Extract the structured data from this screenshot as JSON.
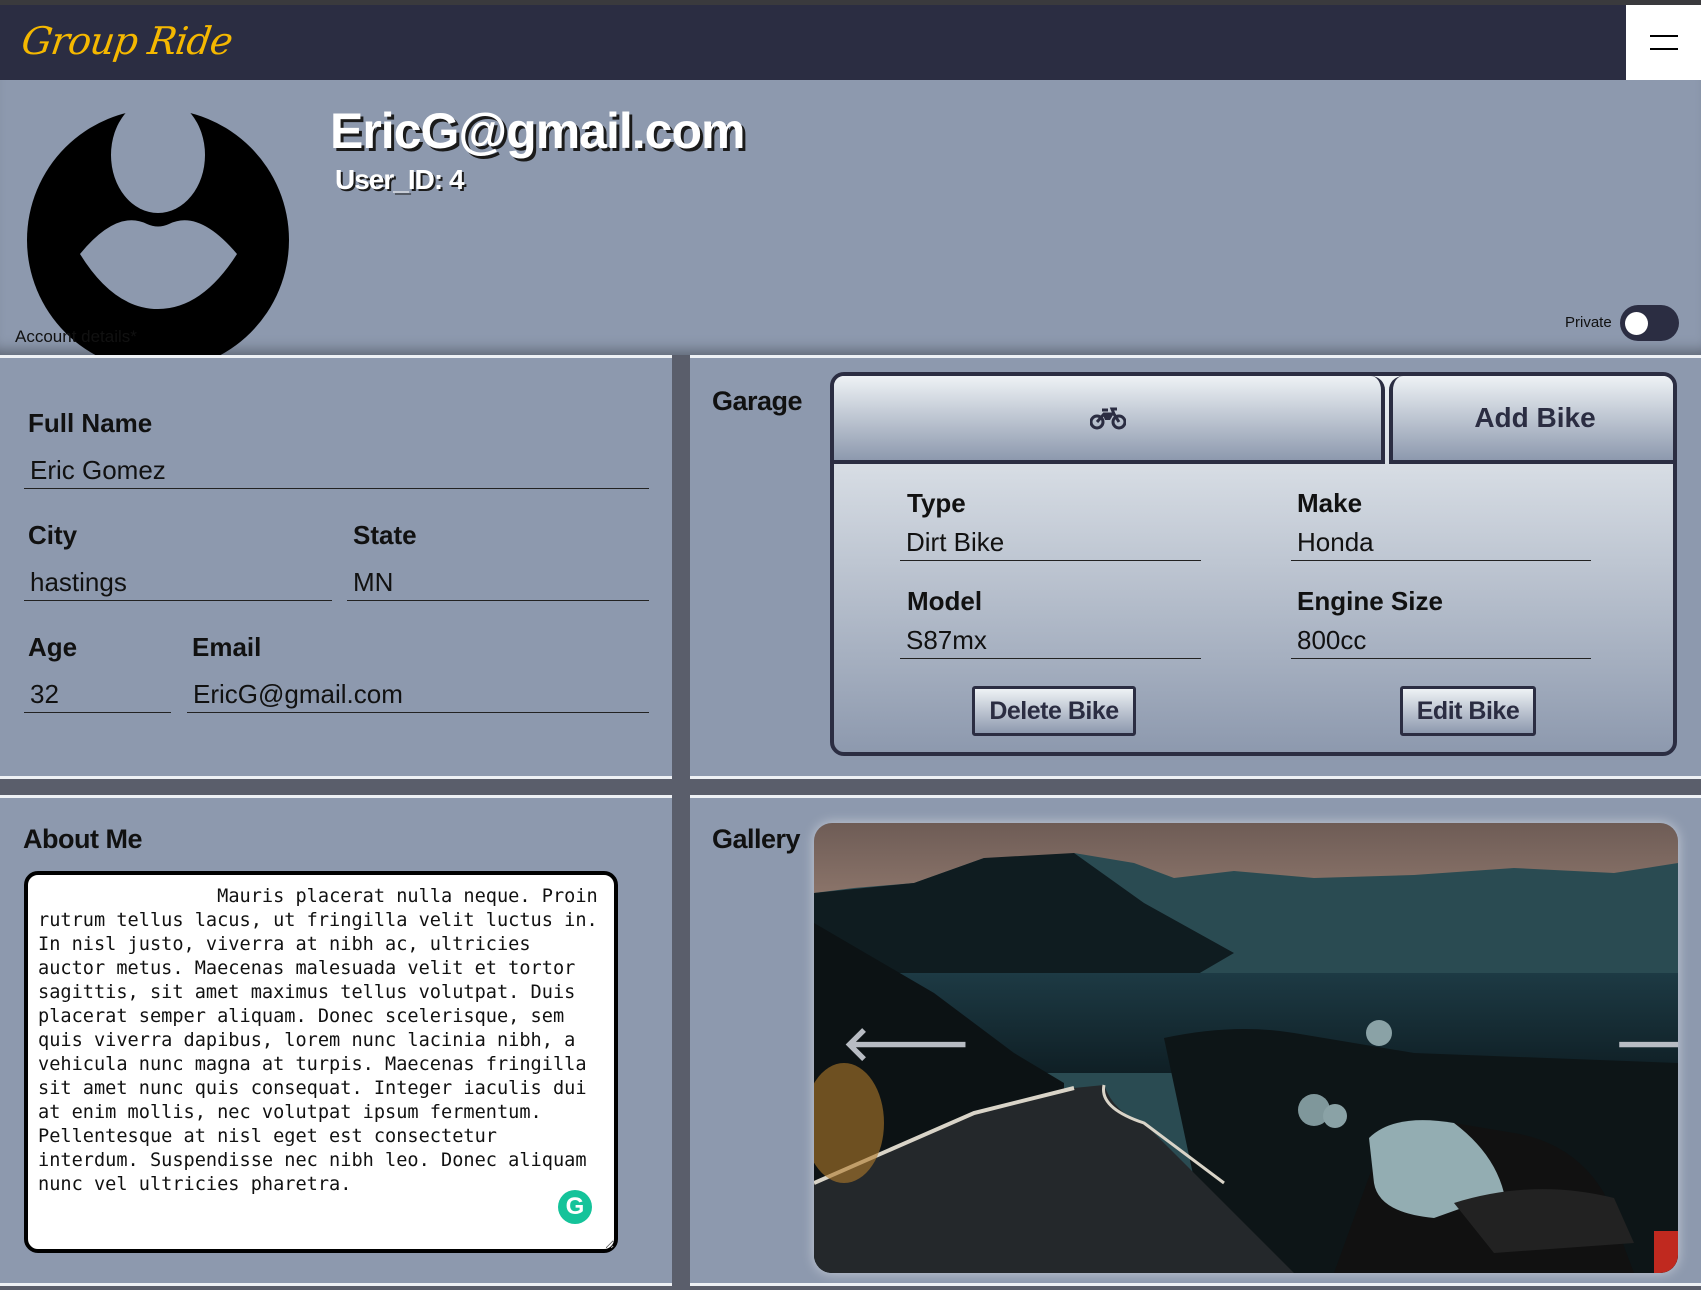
{
  "app": {
    "logo_text": "Group Ride",
    "menu_icon": "hamburger-icon"
  },
  "profile": {
    "email_title": "EricG@gmail.com",
    "user_id": "User_ID: 4",
    "account_details_label": "Account details*",
    "private_label": "Private",
    "private_enabled": false
  },
  "account": {
    "full_name_label": "Full Name",
    "full_name": "Eric Gomez",
    "city_label": "City",
    "city": "hastings",
    "state_label": "State",
    "state": "MN",
    "age_label": "Age",
    "age": "32",
    "email_label": "Email",
    "email": "EricG@gmail.com"
  },
  "garage": {
    "title": "Garage",
    "bike_tab_icon": "motorcycle-icon",
    "add_bike_label": "Add Bike",
    "type_label": "Type",
    "type": "Dirt Bike",
    "make_label": "Make",
    "make": "Honda",
    "model_label": "Model",
    "model": "S87mx",
    "engine_label": "Engine Size",
    "engine": "800cc",
    "delete_label": "Delete Bike",
    "edit_label": "Edit Bike"
  },
  "about": {
    "title": "About Me",
    "text": "                Mauris placerat nulla neque. Proin rutrum tellus lacus, ut fringilla velit luctus in. In nisl justo, viverra at nibh ac, ultricies auctor metus. Maecenas malesuada velit et tortor sagittis, sit amet maximus tellus volutpat. Duis placerat semper aliquam. Donec scelerisque, sem quis viverra dapibus, lorem nunc lacinia nibh, a vehicula nunc magna at turpis. Maecenas fringilla sit amet nunc quis consequat. Integer iaculis dui at enim mollis, nec volutpat ipsum fermentum. Pellentesque at nisl eget est consectetur interdum. Suspendisse nec nibh leo. Donec aliquam nunc vel ultricies pharetra.",
    "grammarly_glyph": "G"
  },
  "gallery": {
    "title": "Gallery",
    "prev_glyph": "🡐",
    "next_glyph": "🡒"
  },
  "colors": {
    "navbar": "#2b2d42",
    "panel": "#8d99ae",
    "logo": "#f5b800",
    "grammarly": "#15c39a"
  }
}
